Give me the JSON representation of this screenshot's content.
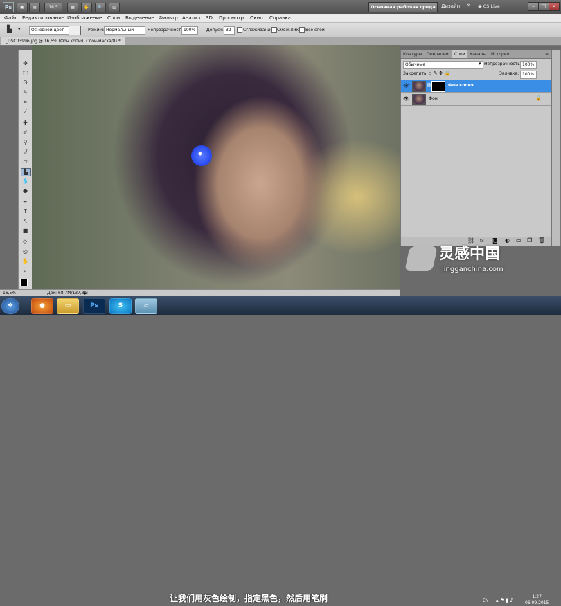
{
  "appbar": {
    "logo": "Ps",
    "zoom": "16,5",
    "workspace": "Основная рабочая среда",
    "design": "Дизайн",
    "cslive": "CS Live",
    "win_min": "–",
    "win_max": "□",
    "win_close": "×"
  },
  "menu": [
    "Файл",
    "Редактирование",
    "Изображение",
    "Слои",
    "Выделение",
    "Фильтр",
    "Анализ",
    "3D",
    "Просмотр",
    "Окно",
    "Справка"
  ],
  "options": {
    "preset": "Основной цвет",
    "mode_label": "Режим:",
    "mode_value": "Нормальный",
    "opacity_label": "Непрозрачность:",
    "opacity_value": "100%",
    "tolerance_label": "Допуск:",
    "tolerance_value": "32",
    "antialias_label": "Сглаживание",
    "contiguous_label": "Смеж.пикс",
    "all_layers_label": "Все слои"
  },
  "document": {
    "tab": "_DSC03996.jpg @ 16,5% (Фон копия, Слой-маска/8) *",
    "status_zoom": "16,5%",
    "status_doc": "Док: 68,7M/137,3M"
  },
  "layers_panel": {
    "tabs": [
      "Контуры",
      "Операции",
      "Слои",
      "Каналы",
      "История"
    ],
    "active_tab": "Слои",
    "blend_mode": "Обычные",
    "opacity_label": "Непрозрачность:",
    "opacity_value": "100%",
    "lock_label": "Закрепить:",
    "fill_label": "Заливка:",
    "fill_value": "100%",
    "layers": [
      {
        "name": "Фон копия",
        "selected": true
      },
      {
        "name": "Фон",
        "selected": false
      }
    ],
    "bottom_icons": [
      "link-icon",
      "fx-icon",
      "mask-icon",
      "adjustment-icon",
      "folder-icon",
      "new-layer-icon",
      "trash-icon"
    ]
  },
  "taskbar": {
    "lang": "EN",
    "time": "1:27",
    "date": "06.09.2015",
    "apps": [
      "start-icon",
      "firefox-icon",
      "folder-icon",
      "photoshop-icon",
      "skype-icon",
      "window-icon"
    ],
    "app_labels": [
      "Ps",
      "S"
    ]
  },
  "subtitle": "让我们用灰色绘制，指定黑色，然后用笔刷",
  "watermark": {
    "cn": "灵感中国",
    "url": "lingganchina.com"
  },
  "colors": {
    "accent_selected": "#3a8ee6",
    "brush_cursor": "#2d4ff0"
  }
}
